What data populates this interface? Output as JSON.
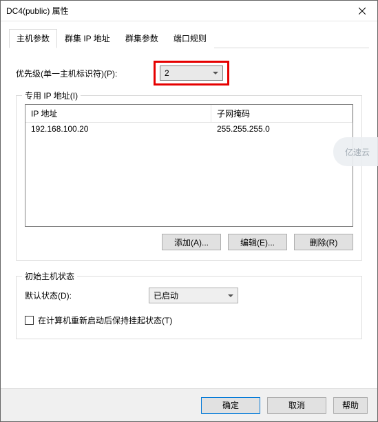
{
  "window": {
    "title": "DC4(public) 属性"
  },
  "tabs": {
    "items": [
      {
        "label": "主机参数"
      },
      {
        "label": "群集 IP 地址"
      },
      {
        "label": "群集参数"
      },
      {
        "label": "端口规则"
      }
    ]
  },
  "priority": {
    "label": "优先级(单一主机标识符)(P):",
    "value": "2"
  },
  "ipgroup": {
    "title": "专用 IP 地址(I)",
    "headers": {
      "ip": "IP 地址",
      "mask": "子网掩码"
    },
    "rows": [
      {
        "ip": "192.168.100.20",
        "mask": "255.255.255.0"
      }
    ],
    "buttons": {
      "add": "添加(A)...",
      "edit": "编辑(E)...",
      "remove": "删除(R)"
    }
  },
  "state": {
    "title": "初始主机状态",
    "label": "默认状态(D):",
    "value": "已启动",
    "checkbox": "在计算机重新启动后保持挂起状态(T)"
  },
  "footer": {
    "ok": "确定",
    "cancel": "取消",
    "help": "帮助"
  },
  "watermark": "亿速云"
}
